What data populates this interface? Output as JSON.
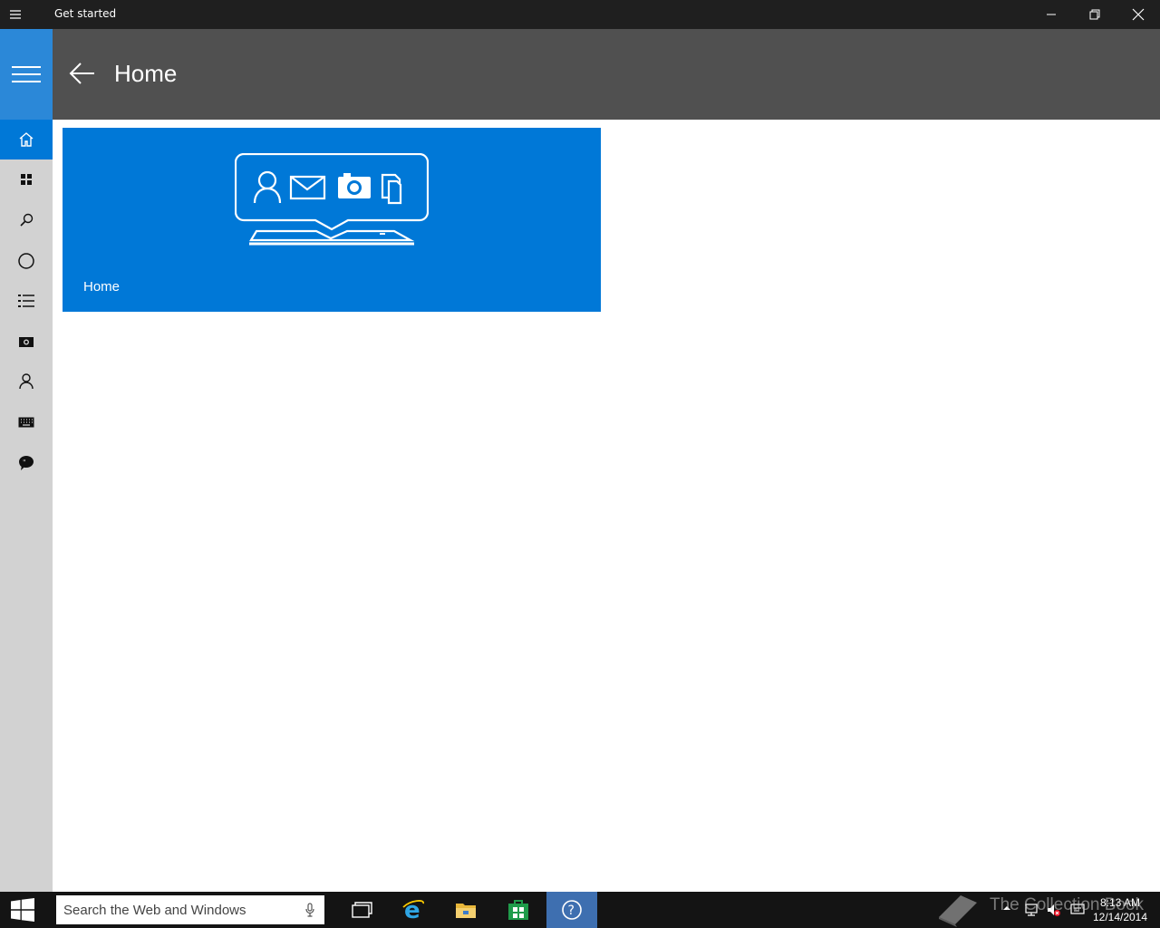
{
  "window": {
    "title": "Get started",
    "menu_icon": "hamburger-icon",
    "controls": [
      "minimize-icon",
      "restore-icon",
      "close-icon"
    ]
  },
  "sidebar": {
    "menu_icon": "hamburger-icon",
    "accent": "#2b88d8",
    "items": [
      {
        "icon": "home-icon",
        "active": true
      },
      {
        "icon": "apps-grid-icon",
        "active": false
      },
      {
        "icon": "search-icon",
        "active": false
      },
      {
        "icon": "cortana-circle-icon",
        "active": false
      },
      {
        "icon": "list-icon",
        "active": false
      },
      {
        "icon": "camera-icon",
        "active": false
      },
      {
        "icon": "person-icon",
        "active": false
      },
      {
        "icon": "keyboard-icon",
        "active": false
      },
      {
        "icon": "feedback-icon",
        "active": false
      }
    ]
  },
  "header": {
    "back_icon": "back-arrow-icon",
    "title": "Home"
  },
  "main": {
    "tiles": [
      {
        "label": "Home",
        "color": "#0078d7",
        "graphic": "devices-speech-bubble-icon"
      }
    ]
  },
  "taskbar": {
    "search_placeholder": "Search the Web and Windows",
    "apps": [
      "task-view-icon",
      "internet-explorer-icon",
      "file-explorer-icon",
      "store-icon",
      "get-started-icon"
    ],
    "active_app": "get-started-icon",
    "tray_icons": [
      "chevron-up-icon",
      "network-icon",
      "volume-muted-icon",
      "action-center-icon"
    ],
    "time": "8:13 AM",
    "date": "12/14/2014"
  },
  "watermark": {
    "text": "The Collection Book"
  },
  "colors": {
    "titlebar": "#1f1f1f",
    "header": "#505050",
    "sidebar": "#d2d2d2",
    "accent": "#0078d7",
    "taskbar": "#141414"
  }
}
